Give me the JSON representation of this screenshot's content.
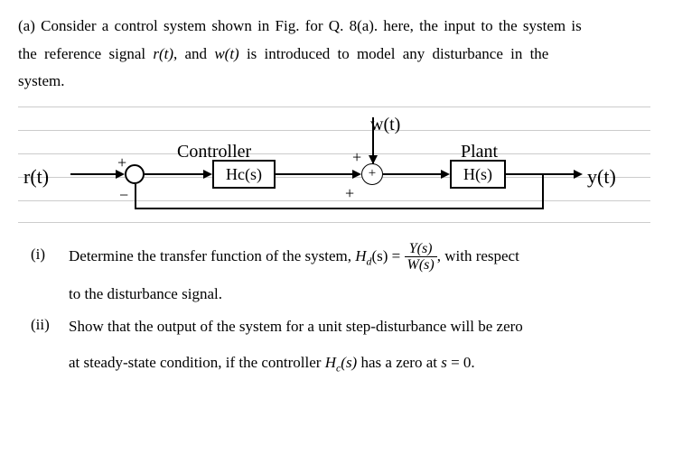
{
  "intro": {
    "line1_a": "(a) Consider a control system shown in Fig. for Q. 8(a). here, the input to the system is",
    "line2_a": "the reference signal ",
    "line2_b": ", and ",
    "line2_c": " is introduced to model any disturbance in the",
    "line3": "system.",
    "r_of_t": "r(t)",
    "w_of_t": "w(t)"
  },
  "diagram": {
    "input": "r(t)",
    "controller_label": "Controller",
    "controller_block": "Hc(s)",
    "disturbance": "w(t)",
    "plant_label": "Plant",
    "plant_block": "H(s)",
    "output": "y(t)",
    "sum2_symbol": "+",
    "plus1": "+",
    "minus1": "−",
    "plus2": "+",
    "plus3": "+"
  },
  "questions": {
    "i": {
      "num": "(i)",
      "a": "Determine the transfer function of the system, ",
      "Hdlabel": "H",
      "Hdsub": "d",
      "eq": "(s) = ",
      "frac_num": "Y(s)",
      "frac_den": "W(s)",
      "b": ", with respect",
      "c": "to the disturbance signal."
    },
    "ii": {
      "num": "(ii)",
      "a": "Show that the output of the system for a unit step-disturbance will be zero",
      "b": "at steady-state condition, if the controller ",
      "Hclabel": "H",
      "Hcsub": "c",
      "Hcs": "(s)",
      "c": " has a zero at ",
      "s": "s",
      "d": " = 0."
    }
  }
}
